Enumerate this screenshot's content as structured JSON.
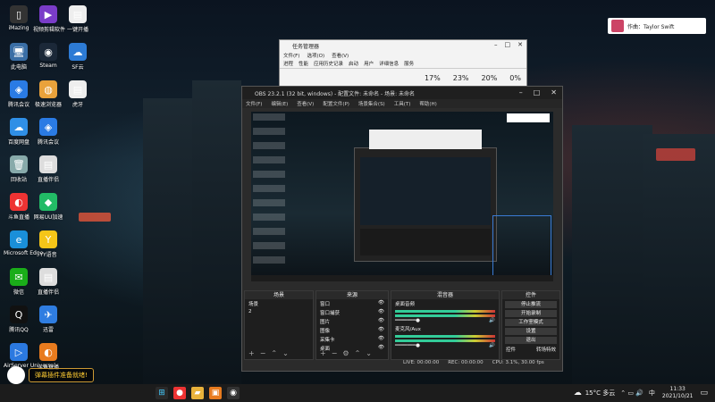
{
  "desktop": {
    "icons": [
      {
        "label": "iMazing",
        "icon": "phone-icon",
        "color": "#333"
      },
      {
        "label": "视频剪辑软件",
        "icon": "video-icon",
        "color": "#7a3cc8"
      },
      {
        "label": "一键开播",
        "icon": "file-icon",
        "color": "#eee"
      },
      {
        "label": "此电脑",
        "icon": "computer-icon",
        "color": "#3a6ea5"
      },
      {
        "label": "Steam",
        "icon": "steam-icon",
        "color": "#1b2838"
      },
      {
        "label": "SF云",
        "icon": "cloud-icon",
        "color": "#2d7bd5"
      },
      {
        "label": "腾讯会议",
        "icon": "meeting-icon",
        "color": "#2a7be4"
      },
      {
        "label": "极速浏览器",
        "icon": "browser-icon",
        "color": "#e9a23b"
      },
      {
        "label": "虎牙",
        "icon": "file-icon",
        "color": "#eee"
      },
      {
        "label": "百度网盘",
        "icon": "cloud-icon",
        "color": "#2f8fe6"
      },
      {
        "label": "腾讯会议",
        "icon": "meeting-icon",
        "color": "#2a7be4"
      },
      {
        "label": "回收站",
        "icon": "trash-icon",
        "color": "#8aa"
      },
      {
        "label": "直播伴侣",
        "icon": "file-icon",
        "color": "#ddd"
      },
      {
        "label": "斗鱼直播",
        "icon": "live-icon",
        "color": "#e33"
      },
      {
        "label": "网易UU加速",
        "icon": "game-icon",
        "color": "#2b6"
      },
      {
        "label": "Microsoft Edge",
        "icon": "edge-icon",
        "color": "#1a8fd9"
      },
      {
        "label": "YY语音",
        "icon": "yy-icon",
        "color": "#f5c518"
      },
      {
        "label": "微信",
        "icon": "wechat-icon",
        "color": "#1aad19"
      },
      {
        "label": "直播伴侣",
        "icon": "file-icon",
        "color": "#ddd"
      },
      {
        "label": "腾讯QQ",
        "icon": "qq-icon",
        "color": "#111"
      },
      {
        "label": "迅雷",
        "icon": "thunder-icon",
        "color": "#2f7de1"
      },
      {
        "label": "AirServer Universal",
        "icon": "airserver-icon",
        "color": "#2b79e0"
      },
      {
        "label": "斗鱼直播",
        "icon": "live-icon",
        "color": "#e87b1e"
      }
    ]
  },
  "notification": {
    "text": "作曲：Taylor Swift"
  },
  "task_manager": {
    "title": "任务管理器",
    "menu": [
      "文件(F)",
      "选项(O)",
      "查看(V)"
    ],
    "tabs": [
      "进程",
      "性能",
      "应用历史记录",
      "启动",
      "用户",
      "详细信息",
      "服务"
    ],
    "percents": [
      "17%",
      "23%",
      "20%",
      "0%"
    ]
  },
  "obs": {
    "title": "OBS 23.2.1 (32 bit, windows) - 配置文件: 未命名 - 场景: 未命名",
    "menu": [
      "文件(F)",
      "编辑(E)",
      "查看(V)",
      "配置文件(P)",
      "场景集合(S)",
      "工具(T)",
      "帮助(H)"
    ],
    "scenes": {
      "header": "场景",
      "items": [
        "场景",
        "2"
      ]
    },
    "sources": {
      "header": "来源",
      "items": [
        "窗口",
        "窗口捕获",
        "图片",
        "图像",
        "采集卡",
        "桌面"
      ]
    },
    "mixer": {
      "header": "混音器",
      "channels": [
        "桌面音频",
        "麦克风/Aux"
      ]
    },
    "controls": {
      "header": "控件",
      "buttons": [
        "停止推流",
        "开始录制",
        "工作室模式",
        "设置",
        "退出"
      ]
    },
    "status": {
      "live": "LIVE: 00:00:00",
      "rec": "REC: 00:00:00",
      "cpu": "CPU: 3.1%, 30.00 fps"
    },
    "dock_tabs": [
      "控件",
      "转场特效"
    ]
  },
  "plugin": {
    "text": "弹幕插件准备就绪!"
  },
  "taskbar": {
    "weather": "15°C 多云",
    "time": "11:33",
    "date": "2021/10/21",
    "ime": "中"
  }
}
